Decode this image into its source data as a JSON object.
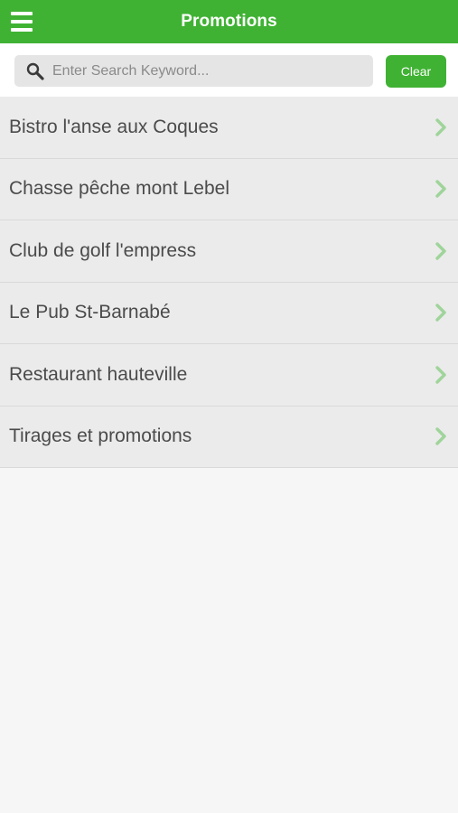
{
  "header": {
    "title": "Promotions",
    "menu_icon": "hamburger-menu-icon",
    "background_color": "#3fb233"
  },
  "search": {
    "placeholder": "Enter Search Keyword...",
    "value": "",
    "icon": "search-icon",
    "clear_label": "Clear"
  },
  "list": {
    "chevron_icon": "chevron-right-icon",
    "chevron_color": "#9fd49a",
    "items": [
      {
        "label": "Bistro l'anse aux Coques"
      },
      {
        "label": "Chasse pêche mont Lebel"
      },
      {
        "label": "Club de golf l'empress"
      },
      {
        "label": "Le Pub St-Barnabé"
      },
      {
        "label": "Restaurant hauteville"
      },
      {
        "label": "Tirages et promotions"
      }
    ]
  }
}
